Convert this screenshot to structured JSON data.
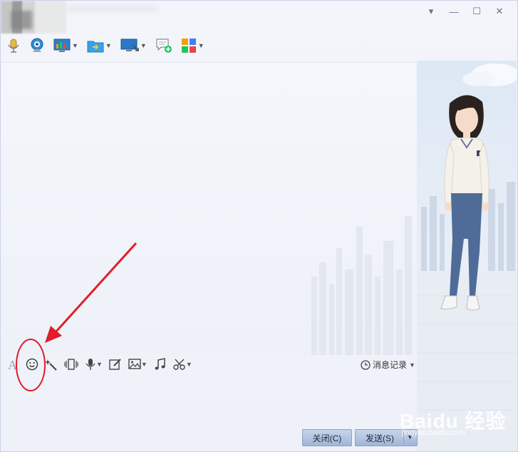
{
  "window": {
    "controls": [
      "▾",
      "—",
      "☐",
      "✕"
    ]
  },
  "top_toolbar": {
    "icons": [
      "microphone-icon",
      "video-icon",
      "screen-share-icon",
      "folder-transfer-icon",
      "remote-desktop-icon",
      "chat-add-icon",
      "apps-grid-icon"
    ]
  },
  "input_toolbar": {
    "icons": [
      "font-icon",
      "emoji-icon",
      "magic-icon",
      "shake-icon",
      "voice-icon",
      "edit-icon",
      "image-icon",
      "music-icon",
      "scissors-icon"
    ]
  },
  "history": {
    "label": "消息记录"
  },
  "buttons": {
    "close": "关闭(C)",
    "send": "发送(S)"
  },
  "watermark": {
    "main": "Baidu 经验",
    "sub": "jingyan.baidu.com"
  },
  "colors": {
    "annotation_red": "#e11d2a",
    "button_blue": "#aebfdc"
  }
}
